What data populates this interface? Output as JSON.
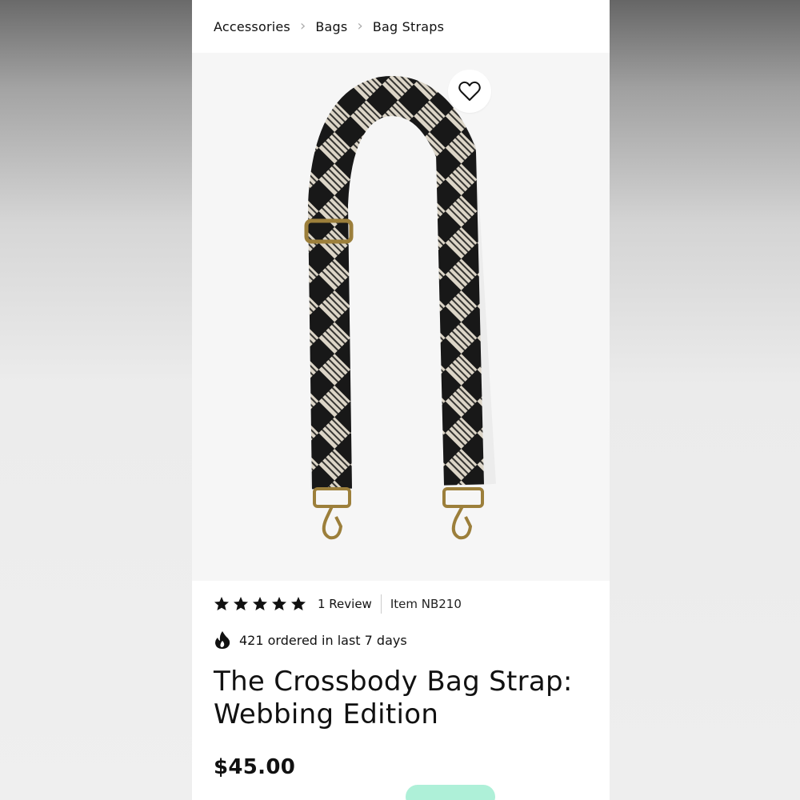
{
  "breadcrumb": {
    "items": [
      "Accessories",
      "Bags",
      "Bag Straps"
    ],
    "separator": "›"
  },
  "hero": {
    "wishlist_icon": "heart-outline-icon",
    "image_subject": "black and cream checkered woven bag strap with brass hardware"
  },
  "rating": {
    "stars": 5,
    "max_stars": 5,
    "reviews_label": "1 Review",
    "item_label": "Item NB210"
  },
  "popularity": {
    "icon": "flame-icon",
    "text": "421 ordered in last 7 days"
  },
  "product": {
    "title": "The Crossbody Bag Strap: Webbing Edition",
    "price": "$45.00"
  },
  "colors": {
    "promo_badge": "#aef0d8",
    "hero_bg": "#f6f6f6",
    "strap_dark": "#1b1b1b",
    "strap_light": "#efe8d8",
    "hardware": "#b0924a"
  }
}
